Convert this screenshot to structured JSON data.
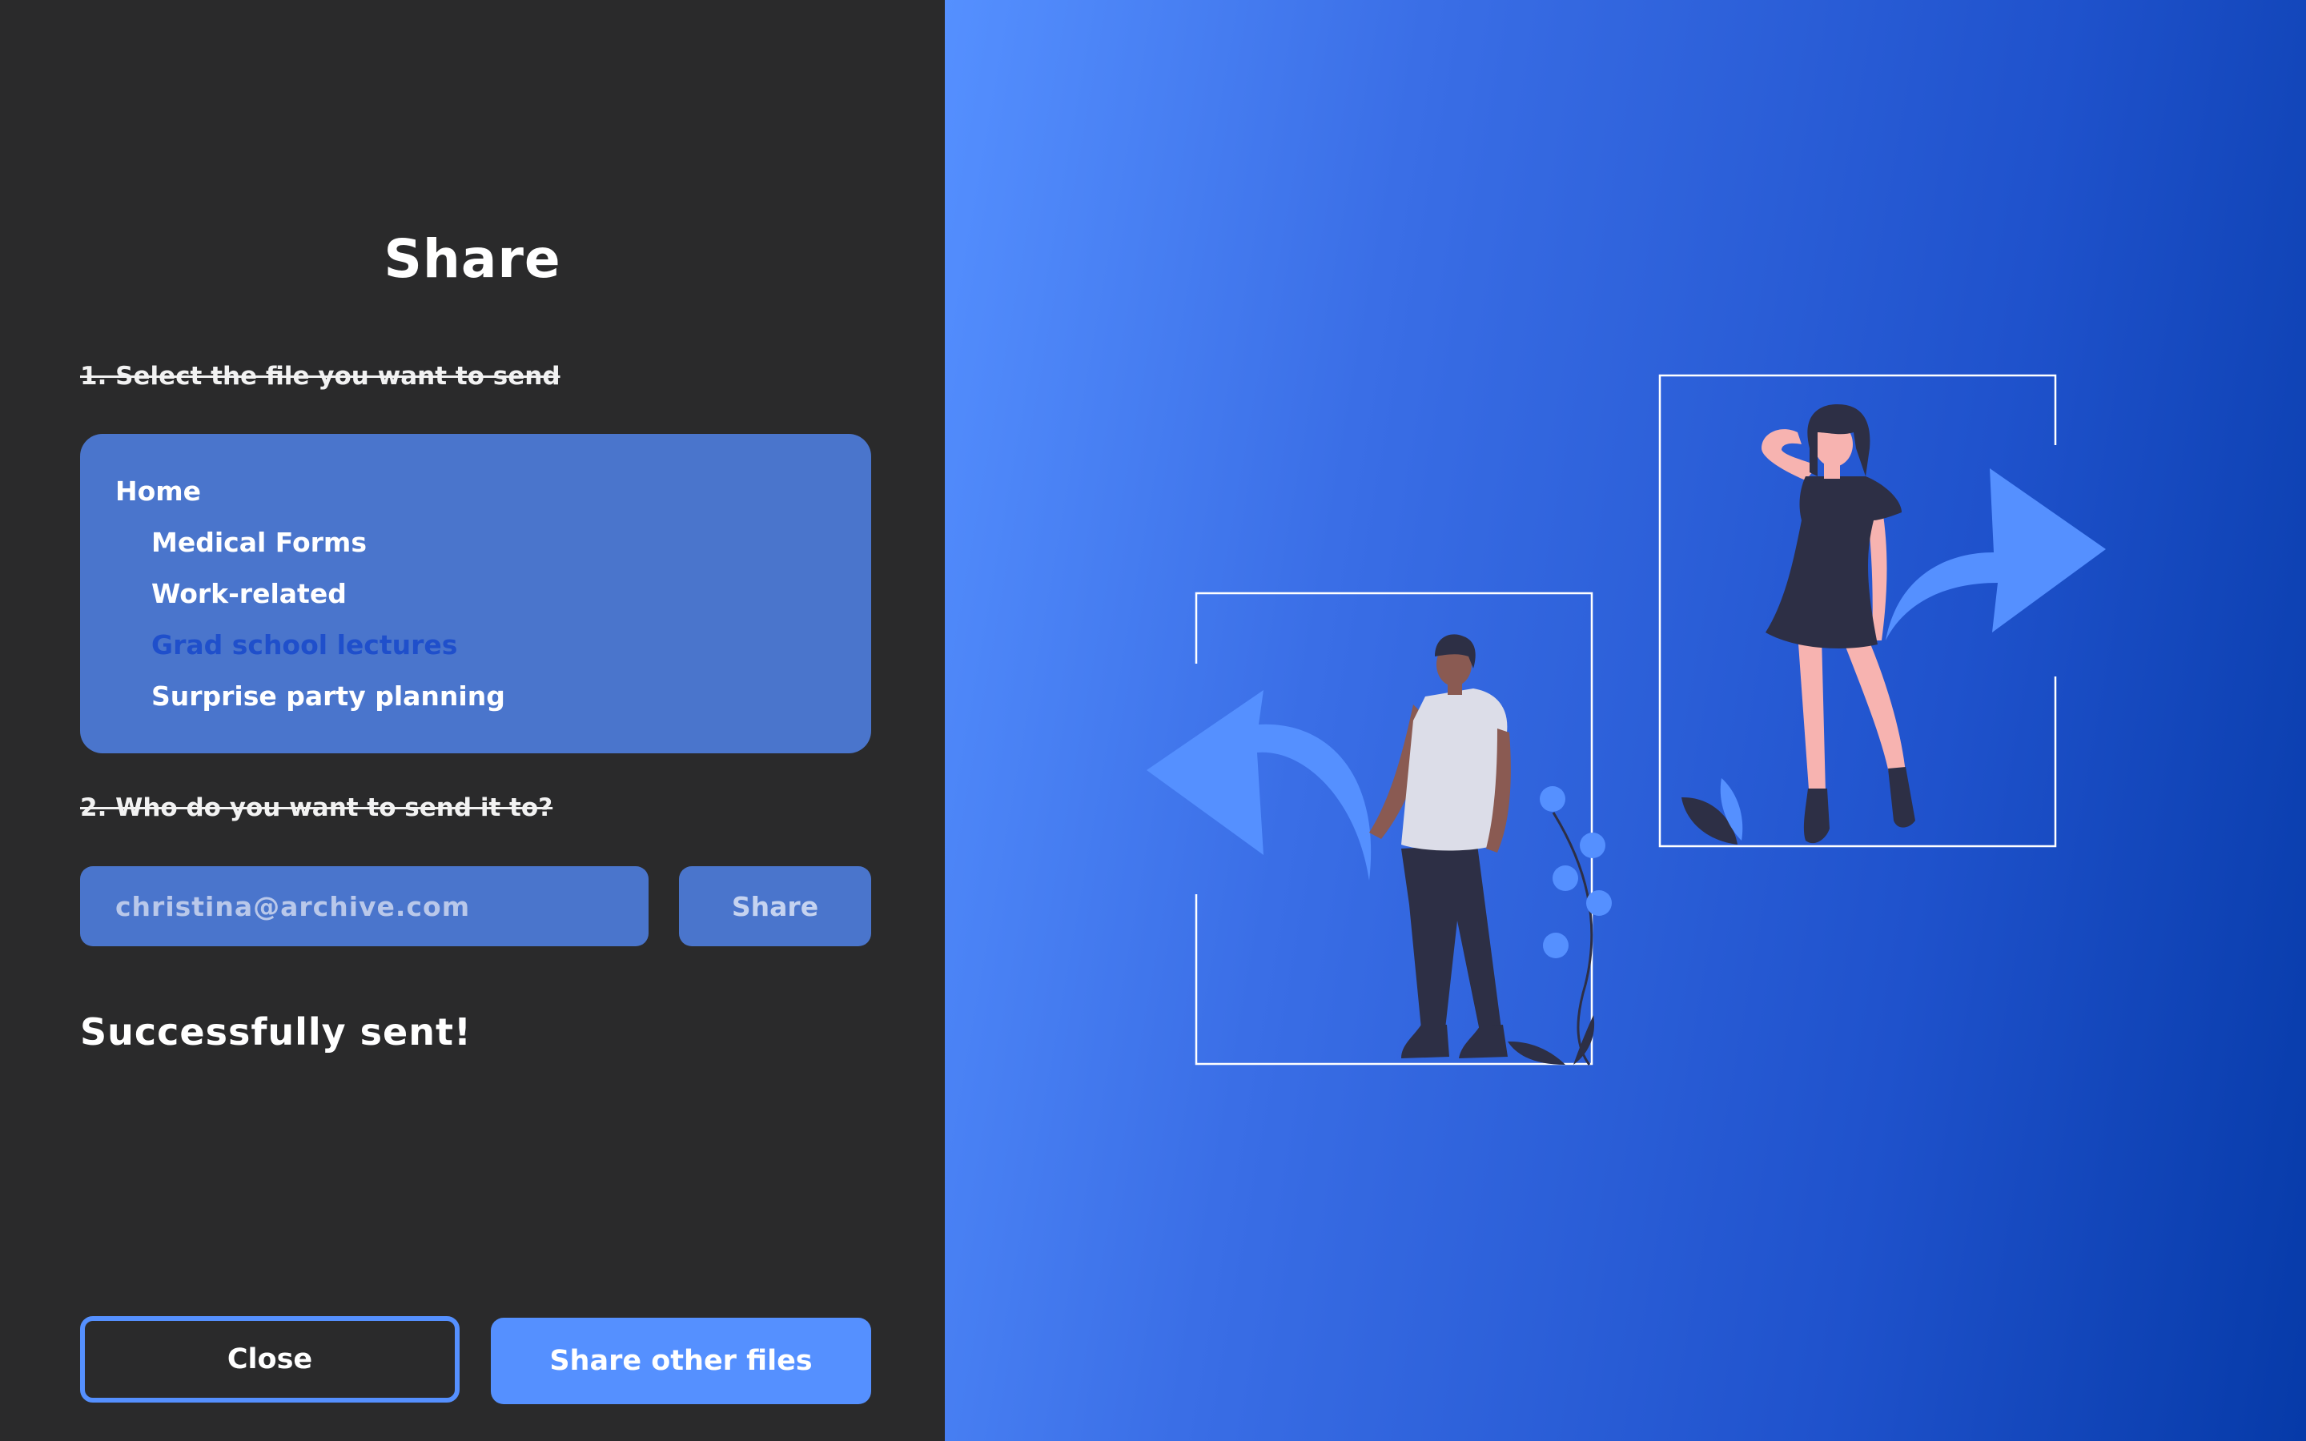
{
  "dialog": {
    "title": "Share"
  },
  "step1": {
    "label": "1. Select the file you want to send"
  },
  "file_tree": {
    "root": "Home",
    "items": [
      {
        "label": "Medical Forms",
        "selected": false
      },
      {
        "label": "Work-related",
        "selected": false
      },
      {
        "label": "Grad school lectures",
        "selected": true
      },
      {
        "label": "Surprise party planning",
        "selected": false
      }
    ]
  },
  "step2": {
    "label": "2. Who do you want to send it to?"
  },
  "recipient": {
    "value": "christina@archive.com"
  },
  "share_button": {
    "label": "Share"
  },
  "status": {
    "message": "Successfully sent!"
  },
  "footer": {
    "close_label": "Close",
    "share_other_label": "Share other files"
  },
  "colors": {
    "panel_bg": "#2a2a2b",
    "accent": "#5590ff",
    "input_bg": "#4a75cc",
    "selected_text": "#1f4fcb",
    "gradient_start": "#5590ff",
    "gradient_end": "#063aa8"
  },
  "illustration": {
    "icons": [
      "arrow-left-icon",
      "arrow-right-icon",
      "man-figure",
      "woman-figure",
      "plant-icon",
      "leaf-icon"
    ]
  }
}
